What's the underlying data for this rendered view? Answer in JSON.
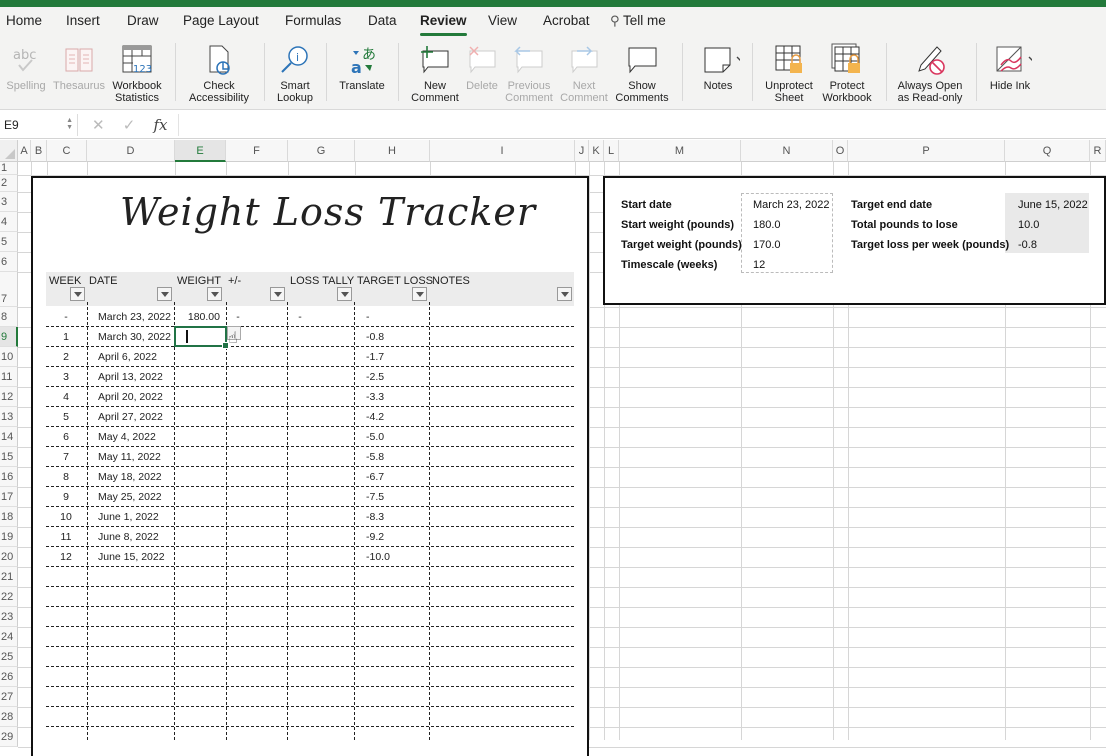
{
  "app": {
    "accent_color": "#237a3b"
  },
  "menu": {
    "tabs": [
      {
        "label": "Home"
      },
      {
        "label": "Insert"
      },
      {
        "label": "Draw"
      },
      {
        "label": "Page Layout"
      },
      {
        "label": "Formulas"
      },
      {
        "label": "Data"
      },
      {
        "label": "Review",
        "active": true
      },
      {
        "label": "View"
      },
      {
        "label": "Acrobat"
      }
    ],
    "tell_me": "Tell me"
  },
  "ribbon": {
    "spelling": "Spelling",
    "thesaurus": "Thesaurus",
    "workbook_statistics": [
      "Workbook",
      "Statistics"
    ],
    "check_accessibility": [
      "Check",
      "Accessibility"
    ],
    "smart_lookup": [
      "Smart",
      "Lookup"
    ],
    "translate": "Translate",
    "new_comment": [
      "New",
      "Comment"
    ],
    "delete": "Delete",
    "previous_comment": [
      "Previous",
      "Comment"
    ],
    "next_comment": [
      "Next",
      "Comment"
    ],
    "show_comments": [
      "Show",
      "Comments"
    ],
    "notes": "Notes",
    "unprotect_sheet": [
      "Unprotect",
      "Sheet"
    ],
    "protect_workbook": [
      "Protect",
      "Workbook"
    ],
    "always_open_read_only": [
      "Always Open",
      "as Read-only"
    ],
    "hide_ink": "Hide Ink"
  },
  "formula_bar": {
    "name_box": "E9",
    "cancel": "✕",
    "enter": "✓",
    "fx": "fx",
    "value": ""
  },
  "columns": [
    "A",
    "B",
    "C",
    "D",
    "E",
    "F",
    "G",
    "H",
    "I",
    "J",
    "K",
    "L",
    "M",
    "N",
    "O",
    "P",
    "Q",
    "R"
  ],
  "selected_column": "E",
  "rows": [
    "1",
    "2",
    "3",
    "4",
    "5",
    "6",
    "7",
    "8",
    "9",
    "10",
    "11",
    "12",
    "13",
    "14",
    "15",
    "16",
    "17",
    "18",
    "19",
    "20",
    "21",
    "22",
    "23",
    "24",
    "25",
    "26",
    "27",
    "28",
    "29"
  ],
  "selected_row": "9",
  "tracker": {
    "title": "Weight Loss Tracker",
    "headers": [
      "WEEK",
      "DATE",
      "WEIGHT",
      "+/-",
      "LOSS TALLY",
      "TARGET LOSS",
      "NOTES"
    ],
    "rows": [
      {
        "week": "-",
        "date": "March 23, 2022",
        "weight": "180.00",
        "change": "-",
        "tally": "-",
        "target": "-"
      },
      {
        "week": "1",
        "date": "March 30, 2022",
        "weight": "",
        "change": "",
        "tally": "",
        "target": "-0.8"
      },
      {
        "week": "2",
        "date": "April 6, 2022",
        "weight": "",
        "change": "",
        "tally": "",
        "target": "-1.7"
      },
      {
        "week": "3",
        "date": "April 13, 2022",
        "weight": "",
        "change": "",
        "tally": "",
        "target": "-2.5"
      },
      {
        "week": "4",
        "date": "April 20, 2022",
        "weight": "",
        "change": "",
        "tally": "",
        "target": "-3.3"
      },
      {
        "week": "5",
        "date": "April 27, 2022",
        "weight": "",
        "change": "",
        "tally": "",
        "target": "-4.2"
      },
      {
        "week": "6",
        "date": "May 4, 2022",
        "weight": "",
        "change": "",
        "tally": "",
        "target": "-5.0"
      },
      {
        "week": "7",
        "date": "May 11, 2022",
        "weight": "",
        "change": "",
        "tally": "",
        "target": "-5.8"
      },
      {
        "week": "8",
        "date": "May 18, 2022",
        "weight": "",
        "change": "",
        "tally": "",
        "target": "-6.7"
      },
      {
        "week": "9",
        "date": "May 25, 2022",
        "weight": "",
        "change": "",
        "tally": "",
        "target": "-7.5"
      },
      {
        "week": "10",
        "date": "June 1, 2022",
        "weight": "",
        "change": "",
        "tally": "",
        "target": "-8.3"
      },
      {
        "week": "11",
        "date": "June 8, 2022",
        "weight": "",
        "change": "",
        "tally": "",
        "target": "-9.2"
      },
      {
        "week": "12",
        "date": "June 15, 2022",
        "weight": "",
        "change": "",
        "tally": "",
        "target": "-10.0"
      }
    ]
  },
  "settings": {
    "inputs": [
      {
        "label": "Start date",
        "value": "March 23, 2022"
      },
      {
        "label": "Start weight (pounds)",
        "value": "180.0"
      },
      {
        "label": "Target weight (pounds)",
        "value": "170.0"
      },
      {
        "label": "Timescale (weeks)",
        "value": "12"
      }
    ],
    "calculated": [
      {
        "label": "Target end date",
        "value": "June 15, 2022"
      },
      {
        "label": "Total pounds to lose",
        "value": "10.0"
      },
      {
        "label": "Target loss per week (pounds)",
        "value": "-0.8"
      }
    ]
  }
}
